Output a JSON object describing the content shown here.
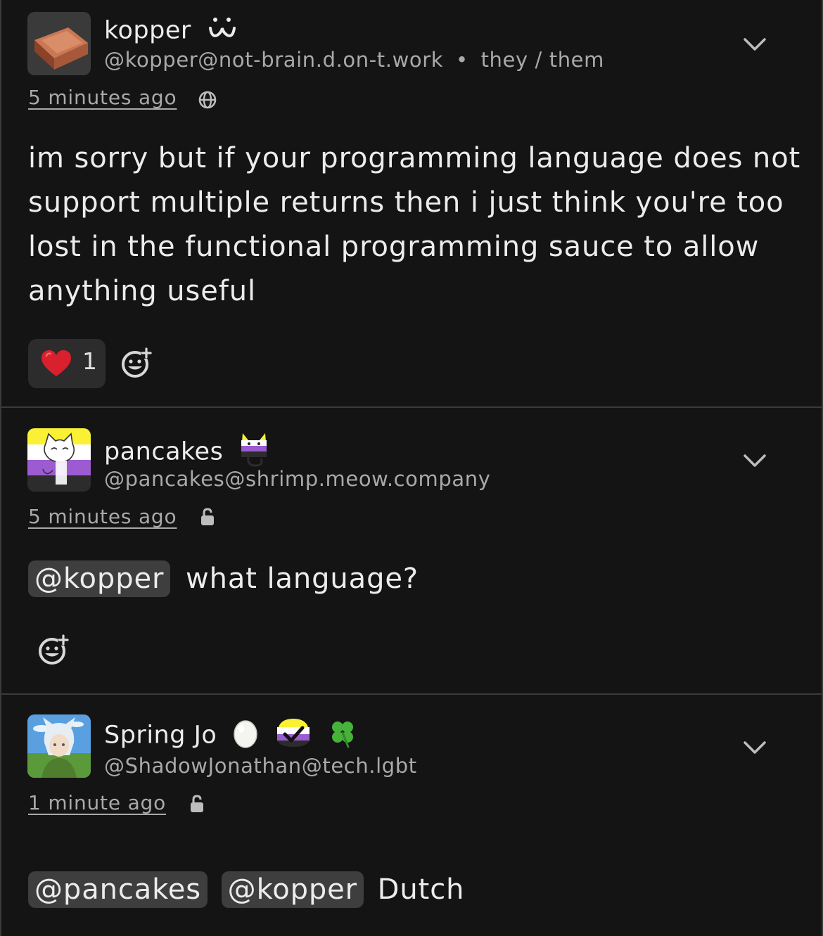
{
  "posts": [
    {
      "display_name": "kopper",
      "name_emojis": [
        "owo-face-emoji"
      ],
      "handle": "@kopper@not-brain.d.on-t.work",
      "pronoun_separator": "•",
      "pronouns": "they / them",
      "timestamp": "5 minutes ago",
      "visibility": "globe-icon",
      "content": "im sorry but if your programming language does not support multiple returns then i just think you're too lost in the functional programming sauce to allow anything useful",
      "reactions": [
        {
          "emoji": "heart",
          "count": "1"
        }
      ]
    },
    {
      "display_name": "pancakes",
      "name_emojis": [
        "nonbinary-cat-emoji"
      ],
      "handle": "@pancakes@shrimp.meow.company",
      "timestamp": "5 minutes ago",
      "visibility": "lock-open-icon",
      "mentions": [
        "@kopper"
      ],
      "content": "what language?"
    },
    {
      "display_name": "Spring Jo",
      "name_emojis": [
        "egg-emoji",
        "nonbinary-check-emoji",
        "clover-emoji"
      ],
      "handle": "@ShadowJonathan@tech.lgbt",
      "timestamp": "1 minute ago",
      "visibility": "lock-open-icon",
      "mentions": [
        "@pancakes",
        "@kopper"
      ],
      "content": "Dutch"
    }
  ],
  "colors": {
    "background": "#141414",
    "text": "#ececec",
    "muted": "#a9a9a9",
    "mention_bg": "#3e3e3e",
    "divider": "#3a3a3a"
  }
}
